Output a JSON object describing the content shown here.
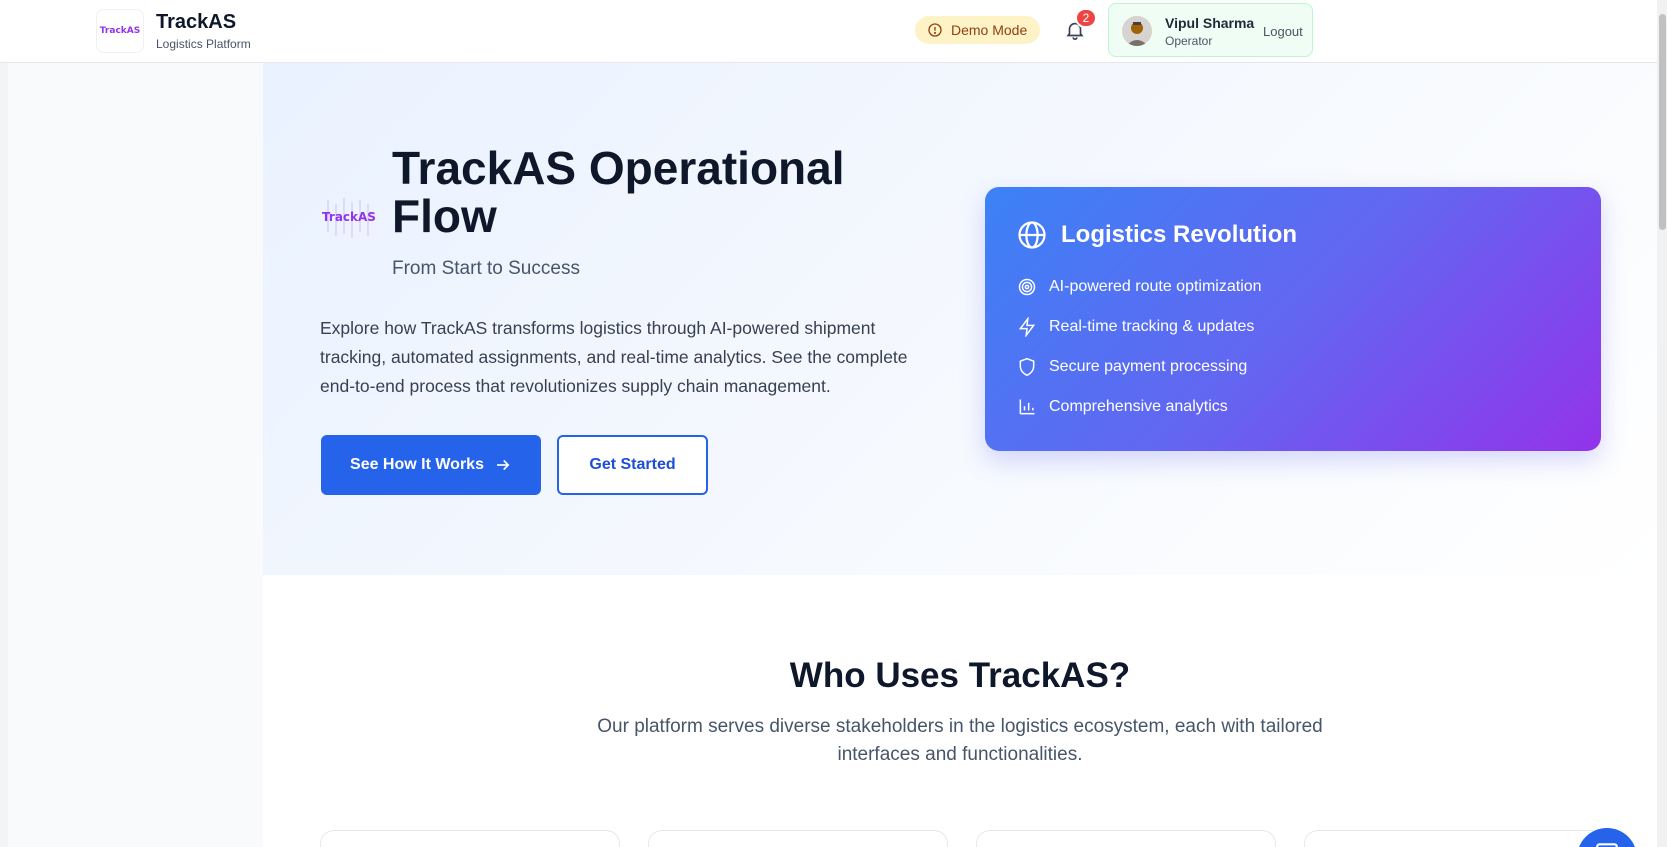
{
  "header": {
    "brand_title": "TrackAS",
    "brand_subtitle": "Logistics Platform",
    "logo_text": "TrackAS",
    "demo_mode_label": "Demo Mode",
    "notification_count": "2",
    "user": {
      "name": "Vipul Sharma",
      "role": "Operator",
      "logout_label": "Logout"
    }
  },
  "hero": {
    "logo_text": "TrackAS",
    "title": "TrackAS Operational Flow",
    "subtitle": "From Start to Success",
    "description": "Explore how TrackAS transforms logistics through AI-powered shipment tracking, automated assignments, and real-time analytics. See the complete end-to-end process that revolutionizes supply chain management.",
    "primary_button": "See How It Works",
    "secondary_button": "Get Started"
  },
  "revolution_card": {
    "title": "Logistics Revolution",
    "items": [
      {
        "label": "AI-powered route optimization",
        "icon": "target-icon"
      },
      {
        "label": "Real-time tracking & updates",
        "icon": "lightning-icon"
      },
      {
        "label": "Secure payment processing",
        "icon": "shield-icon"
      },
      {
        "label": "Comprehensive analytics",
        "icon": "bar-chart-icon"
      }
    ]
  },
  "who_uses": {
    "title": "Who Uses TrackAS?",
    "description": "Our platform serves diverse stakeholders in the logistics ecosystem, each with tailored interfaces and functionalities."
  },
  "colors": {
    "primary": "#2563eb",
    "gradient_start": "#3b82f6",
    "gradient_end": "#9333ea",
    "demo_badge_bg": "#fef3c7",
    "notification_badge": "#ef4444"
  }
}
